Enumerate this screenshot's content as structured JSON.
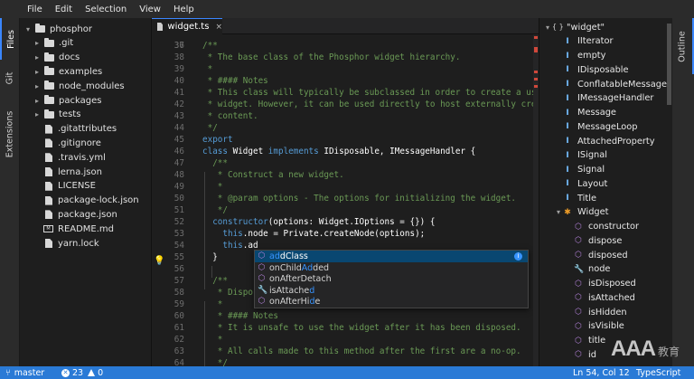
{
  "menu": [
    "File",
    "Edit",
    "Selection",
    "View",
    "Help"
  ],
  "left_tabs": [
    "Files",
    "Git",
    "Extensions"
  ],
  "file_tree": {
    "root": "phosphor",
    "items": [
      {
        "label": ".git",
        "kind": "folder"
      },
      {
        "label": "docs",
        "kind": "folder"
      },
      {
        "label": "examples",
        "kind": "folder"
      },
      {
        "label": "node_modules",
        "kind": "folder"
      },
      {
        "label": "packages",
        "kind": "folder"
      },
      {
        "label": "tests",
        "kind": "folder"
      },
      {
        "label": ".gitattributes",
        "kind": "file"
      },
      {
        "label": ".gitignore",
        "kind": "file"
      },
      {
        "label": ".travis.yml",
        "kind": "file"
      },
      {
        "label": "lerna.json",
        "kind": "file"
      },
      {
        "label": "LICENSE",
        "kind": "file"
      },
      {
        "label": "package-lock.json",
        "kind": "file"
      },
      {
        "label": "package.json",
        "kind": "file"
      },
      {
        "label": "README.md",
        "kind": "markdown"
      },
      {
        "label": "yarn.lock",
        "kind": "file"
      }
    ]
  },
  "editor": {
    "tab_label": "widget.ts",
    "tab_close": "×",
    "top_partial_number": "36",
    "lines": [
      {
        "num": "37",
        "parts": [
          {
            "c": "c",
            "t": "/**"
          }
        ]
      },
      {
        "num": "38",
        "parts": [
          {
            "c": "c",
            "t": " * The base class of the Phosphor widget hierarchy."
          }
        ]
      },
      {
        "num": "39",
        "parts": [
          {
            "c": "c",
            "t": " *"
          }
        ]
      },
      {
        "num": "40",
        "parts": [
          {
            "c": "c",
            "t": " * #### Notes"
          }
        ]
      },
      {
        "num": "41",
        "parts": [
          {
            "c": "c",
            "t": " * This class will typically be subclassed in order to create a useful"
          }
        ]
      },
      {
        "num": "42",
        "parts": [
          {
            "c": "c",
            "t": " * widget. However, it can be used directly to host externally created"
          }
        ]
      },
      {
        "num": "43",
        "parts": [
          {
            "c": "c",
            "t": " * content."
          }
        ]
      },
      {
        "num": "44",
        "parts": [
          {
            "c": "c",
            "t": " */"
          }
        ]
      },
      {
        "num": "45",
        "parts": [
          {
            "c": "k",
            "t": "export"
          }
        ]
      },
      {
        "num": "46",
        "parts": [
          {
            "c": "k",
            "t": "class"
          },
          {
            "c": "t",
            "t": " Widget "
          },
          {
            "c": "k",
            "t": "implements"
          },
          {
            "c": "t",
            "t": " IDisposable, IMessageHandler {"
          }
        ]
      },
      {
        "num": "47",
        "parts": [
          {
            "c": "c",
            "t": "  /**"
          }
        ]
      },
      {
        "num": "48",
        "parts": [
          {
            "c": "c",
            "t": "   * Construct a new widget."
          }
        ]
      },
      {
        "num": "49",
        "parts": [
          {
            "c": "c",
            "t": "   *"
          }
        ]
      },
      {
        "num": "50",
        "parts": [
          {
            "c": "c",
            "t": "   * @param options - The options for initializing the widget."
          }
        ]
      },
      {
        "num": "51",
        "parts": [
          {
            "c": "c",
            "t": "   */"
          }
        ]
      },
      {
        "num": "52",
        "parts": [
          {
            "c": "k",
            "t": "  constructor"
          },
          {
            "c": "t",
            "t": "(options: Widget.IOptions = {}) {"
          }
        ]
      },
      {
        "num": "53",
        "parts": [
          {
            "c": "k",
            "t": "    this"
          },
          {
            "c": "t",
            "t": ".node = Private.createNode(options);"
          }
        ]
      },
      {
        "num": "54",
        "parts": [
          {
            "c": "k",
            "t": "    this"
          },
          {
            "c": "t",
            "t": ".ad"
          }
        ]
      },
      {
        "num": "55",
        "parts": [
          {
            "c": "t",
            "t": "  }"
          }
        ]
      },
      {
        "num": "56",
        "parts": [
          {
            "c": "t",
            "t": ""
          }
        ]
      },
      {
        "num": "57",
        "parts": [
          {
            "c": "c",
            "t": "  /**"
          }
        ]
      },
      {
        "num": "58",
        "parts": [
          {
            "c": "c",
            "t": "   * Dispos"
          }
        ]
      },
      {
        "num": "59",
        "parts": [
          {
            "c": "c",
            "t": "   *"
          }
        ]
      },
      {
        "num": "60",
        "parts": [
          {
            "c": "c",
            "t": "   * #### Notes"
          }
        ]
      },
      {
        "num": "61",
        "parts": [
          {
            "c": "c",
            "t": "   * It is unsafe to use the widget after it has been disposed."
          }
        ]
      },
      {
        "num": "62",
        "parts": [
          {
            "c": "c",
            "t": "   *"
          }
        ]
      },
      {
        "num": "63",
        "parts": [
          {
            "c": "c",
            "t": "   * All calls made to this method after the first are a no-op."
          }
        ]
      },
      {
        "num": "64",
        "parts": [
          {
            "c": "c",
            "t": "   */"
          }
        ]
      }
    ],
    "suggestions": [
      {
        "pre": "",
        "hl": "ad",
        "post": "dClass",
        "icon": "cube",
        "selected": true
      },
      {
        "pre": "onChild",
        "hl": "Ad",
        "post": "ded",
        "icon": "cube",
        "selected": false
      },
      {
        "pre": "onAfterDetach",
        "hl": "",
        "post": "",
        "icon": "cube",
        "selected": false
      },
      {
        "pre": "isAttache",
        "hl": "d",
        "post": "",
        "icon": "wrench",
        "selected": false
      },
      {
        "pre": "onAfterHi",
        "hl": "d",
        "post": "e",
        "icon": "cube",
        "selected": false
      }
    ]
  },
  "outline": {
    "tab_label": "Outline",
    "root": "\"widget\"",
    "root_icon": "{ }",
    "items": [
      {
        "label": "IIterator",
        "icon": "interface",
        "indent": 1
      },
      {
        "label": "empty",
        "icon": "interface",
        "indent": 1
      },
      {
        "label": "IDisposable",
        "icon": "interface",
        "indent": 1
      },
      {
        "label": "ConflatableMessage",
        "icon": "interface",
        "indent": 1
      },
      {
        "label": "IMessageHandler",
        "icon": "interface",
        "indent": 1
      },
      {
        "label": "Message",
        "icon": "interface",
        "indent": 1
      },
      {
        "label": "MessageLoop",
        "icon": "interface",
        "indent": 1
      },
      {
        "label": "AttachedProperty",
        "icon": "interface",
        "indent": 1
      },
      {
        "label": "ISignal",
        "icon": "interface",
        "indent": 1
      },
      {
        "label": "Signal",
        "icon": "interface",
        "indent": 1
      },
      {
        "label": "Layout",
        "icon": "interface",
        "indent": 1
      },
      {
        "label": "Title",
        "icon": "interface",
        "indent": 1
      },
      {
        "label": "Widget",
        "icon": "class",
        "indent": 0
      },
      {
        "label": "constructor",
        "icon": "method",
        "indent": 2
      },
      {
        "label": "dispose",
        "icon": "method",
        "indent": 2
      },
      {
        "label": "disposed",
        "icon": "method",
        "indent": 2
      },
      {
        "label": "node",
        "icon": "wrench",
        "indent": 2
      },
      {
        "label": "isDisposed",
        "icon": "method",
        "indent": 2
      },
      {
        "label": "isAttached",
        "icon": "method",
        "indent": 2
      },
      {
        "label": "isHidden",
        "icon": "method",
        "indent": 2
      },
      {
        "label": "isVisible",
        "icon": "method",
        "indent": 2
      },
      {
        "label": "title",
        "icon": "method",
        "indent": 2
      },
      {
        "label": "id",
        "icon": "method",
        "indent": 2
      }
    ]
  },
  "status": {
    "branch": "master",
    "errors": "23",
    "warnings": "0",
    "cursor": "Ln 54, Col 12",
    "language": "TypeScript"
  },
  "watermark": {
    "text": "AAA",
    "sub": "教育"
  },
  "colors": {
    "accent": "#3a86ff",
    "status_bar": "#2a7ad6",
    "comment": "#6a9955",
    "keyword": "#569cd6",
    "error_mark": "#d0483b"
  }
}
